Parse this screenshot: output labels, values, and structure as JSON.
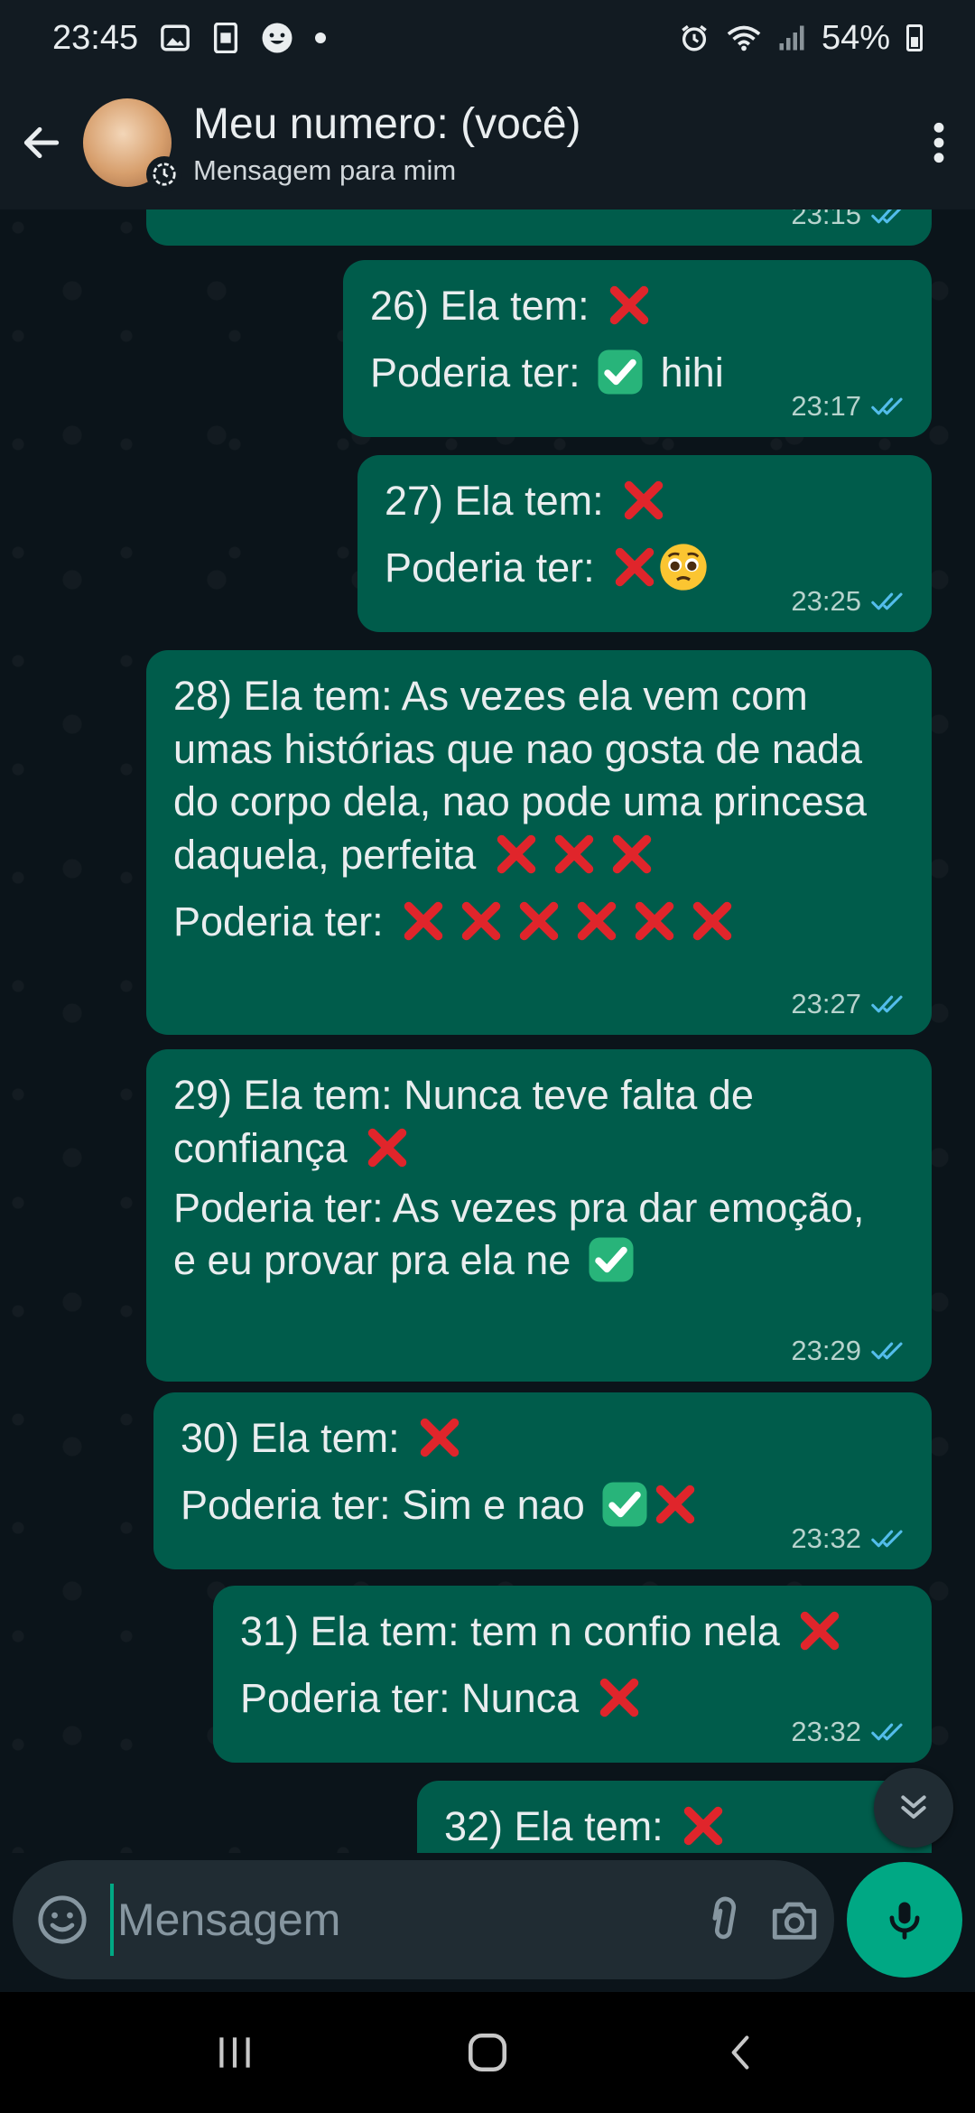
{
  "status_bar": {
    "time": "23:45",
    "battery": "54%"
  },
  "header": {
    "title": "Meu numero: (você)",
    "subtitle": "Mensagem para mim"
  },
  "messages": [
    {
      "id": "25",
      "partial": true,
      "time": "23:15"
    },
    {
      "id": "26",
      "line1": "26) Ela tem:",
      "line2": "Poderia ter:",
      "line2_suffix": "hihi",
      "time": "23:17"
    },
    {
      "id": "27",
      "line1": "27) Ela tem:",
      "line2": "Poderia ter:",
      "time": "23:25"
    },
    {
      "id": "28",
      "text": "28) Ela tem: As vezes ela vem com umas histórias que nao gosta de nada do corpo dela, nao pode uma princesa daquela, perfeita",
      "line2": "Poderia ter:",
      "time": "23:27"
    },
    {
      "id": "29",
      "text": "29) Ela tem: Nunca teve falta de confiança",
      "line2": "Poderia ter: As vezes pra dar emoção, e eu provar pra ela ne",
      "time": "23:29"
    },
    {
      "id": "30",
      "line1": "30) Ela tem:",
      "line2": "Poderia ter: Sim e nao",
      "time": "23:32"
    },
    {
      "id": "31",
      "line1": "31) Ela tem: tem n confio nela",
      "line2": "Poderia ter: Nunca",
      "time": "23:32"
    },
    {
      "id": "32",
      "partial": true,
      "line1": "32) Ela tem:"
    }
  ],
  "composer": {
    "placeholder": "Mensagem"
  },
  "icons": {
    "cross": "cross-mark-emoji",
    "check": "check-mark-button-emoji",
    "pleading": "pleading-face-emoji",
    "read_receipt": "double-check-icon"
  },
  "colors": {
    "bubble": "#005c4b",
    "background": "#0b141a",
    "header": "#121b22",
    "accent": "#00a884",
    "read_ticks": "#53bdeb"
  }
}
